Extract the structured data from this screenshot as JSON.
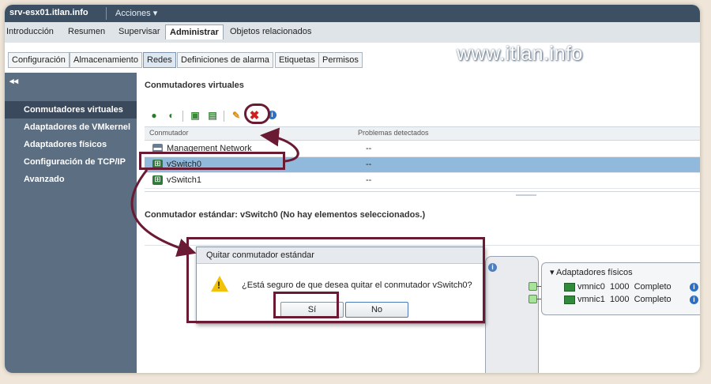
{
  "titlebar": {
    "host": "srv-esx01.itlan.info",
    "actions": "Acciones ▾"
  },
  "main_tabs": [
    {
      "label": "Introducción"
    },
    {
      "label": "Resumen"
    },
    {
      "label": "Supervisar"
    },
    {
      "label": "Administrar",
      "active": true
    },
    {
      "label": "Objetos relacionados"
    }
  ],
  "sub_tabs": [
    {
      "label": "Configuración"
    },
    {
      "label": "Almacenamiento"
    },
    {
      "label": "Redes",
      "active": true
    },
    {
      "label": "Definiciones de alarma"
    },
    {
      "label": "Etiquetas"
    },
    {
      "label": "Permisos"
    }
  ],
  "watermark": "www.itlan.info",
  "sidebar": {
    "collapse": "◂◂",
    "items": [
      {
        "label": "Conmutadores virtuales",
        "active": true
      },
      {
        "label": "Adaptadores de VMkernel"
      },
      {
        "label": "Adaptadores físicos"
      },
      {
        "label": "Configuración de TCP/IP"
      },
      {
        "label": "Avanzado"
      }
    ]
  },
  "main": {
    "title": "Conmutadores virtuales",
    "columns": [
      "Conmutador",
      "Problemas detectados"
    ],
    "rows": [
      {
        "name": "Management Network",
        "problems": "--"
      },
      {
        "name": "vSwitch0",
        "problems": "--",
        "selected": true
      },
      {
        "name": "vSwitch1",
        "problems": "--"
      }
    ],
    "status": "Conmutador estándar: vSwitch0 (No hay elementos seleccionados.)"
  },
  "diagram": {
    "title": "Adaptadores físicos",
    "nics": [
      {
        "name": "vmnic0",
        "speed": "1000",
        "duplex": "Completo"
      },
      {
        "name": "vmnic1",
        "speed": "1000",
        "duplex": "Completo"
      }
    ]
  },
  "dialog": {
    "title": "Quitar conmutador estándar",
    "message": "¿Está seguro de que desea quitar el conmutador vSwitch0?",
    "yes": "Sí",
    "no": "No"
  },
  "colors": {
    "annotation": "#6b1a34",
    "selection": "#91b9dc",
    "sidebar": "#5c6e82"
  }
}
